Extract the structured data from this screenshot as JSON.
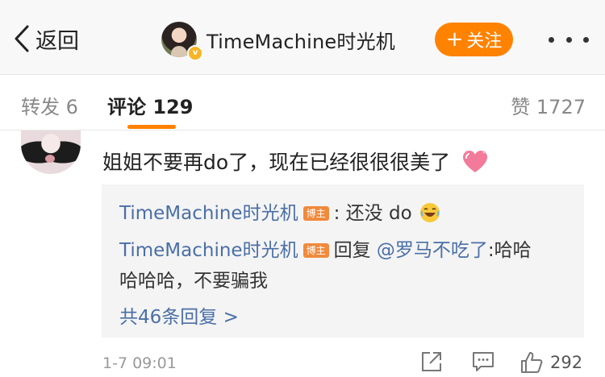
{
  "header": {
    "back_label": "返回",
    "blogger_name": "TimeMachine时光机",
    "follow_label": "关注",
    "follow_plus": "+",
    "verified_badge": "v",
    "follow_color": "#ff8200"
  },
  "tabs": {
    "repost": "转发 6",
    "comment": "评论 129",
    "like": "赞 1727",
    "active_color": "#ff8200"
  },
  "comment": {
    "text": "姐姐不要再do了，现在已经很很很美了",
    "emoji": "heart-emoji",
    "replies": [
      {
        "author": "TimeMachine时光机",
        "badge": "博主",
        "text": ": 还没 do",
        "emoji": "laugh-emoji"
      },
      {
        "author": "TimeMachine时光机",
        "badge": "博主",
        "prefix": "回复",
        "mention": "@罗马不吃了",
        "text": ":哈哈",
        "text_continued": "哈哈哈，不要骗我"
      }
    ],
    "view_replies": "共46条回复 >",
    "time": "1-7 09:01",
    "like_count": "292",
    "link_color": "#4a6fa6"
  },
  "icons": [
    "back-chevron-icon",
    "more-dots-icon",
    "share-icon",
    "comment-icon",
    "thumbs-up-icon"
  ]
}
